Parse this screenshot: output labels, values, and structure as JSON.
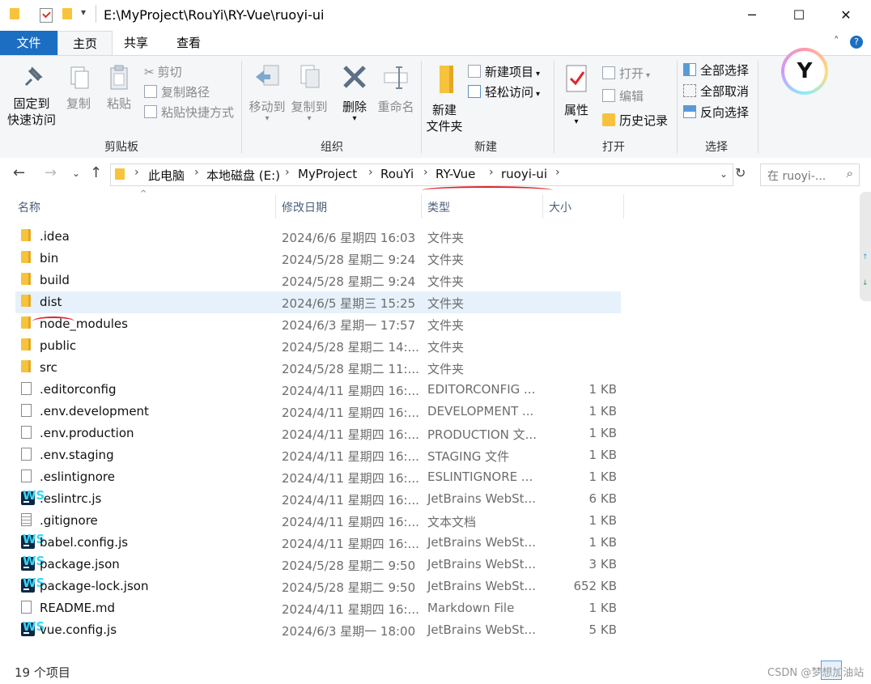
{
  "window": {
    "title": "E:\\MyProject\\RouYi\\RY-Vue\\ruoyi-ui",
    "min_glyph": "─",
    "max_glyph": "☐",
    "close_glyph": "✕"
  },
  "tabs": [
    "文件",
    "主页",
    "共享",
    "查看"
  ],
  "ribbon": {
    "clipboard": {
      "pin_label_1": "固定到",
      "pin_label_2": "快速访问",
      "copy": "复制",
      "paste": "粘贴",
      "cut": "剪切",
      "copy_path": "复制路径",
      "paste_shortcut": "粘贴快捷方式",
      "group": "剪贴板"
    },
    "organize": {
      "move_to": "移动到",
      "copy_to": "复制到",
      "delete": "删除",
      "rename": "重命名",
      "group": "组织"
    },
    "new": {
      "new_folder_1": "新建",
      "new_folder_2": "文件夹",
      "new_item": "新建项目",
      "easy_access": "轻松访问",
      "group": "新建"
    },
    "open": {
      "properties": "属性",
      "open": "打开",
      "edit": "编辑",
      "history": "历史记录",
      "group": "打开"
    },
    "select": {
      "select_all": "全部选择",
      "select_none": "全部取消",
      "invert": "反向选择",
      "group": "选择"
    }
  },
  "address": {
    "crumbs": [
      "此电脑",
      "本地磁盘 (E:)",
      "MyProject",
      "RouYi",
      "RY-Vue",
      "ruoyi-ui"
    ],
    "search_placeholder": "在 ruoyi-..."
  },
  "columns": [
    "名称",
    "修改日期",
    "类型",
    "大小"
  ],
  "files": [
    {
      "name": ".idea",
      "date": "2024/6/6 星期四 16:03",
      "type": "文件夹",
      "size": "",
      "icon": "folder"
    },
    {
      "name": "bin",
      "date": "2024/5/28 星期二 9:24",
      "type": "文件夹",
      "size": "",
      "icon": "folder"
    },
    {
      "name": "build",
      "date": "2024/5/28 星期二 9:24",
      "type": "文件夹",
      "size": "",
      "icon": "folder"
    },
    {
      "name": "dist",
      "date": "2024/6/5 星期三 15:25",
      "type": "文件夹",
      "size": "",
      "icon": "folder",
      "selected": true
    },
    {
      "name": "node_modules",
      "date": "2024/6/3 星期一 17:57",
      "type": "文件夹",
      "size": "",
      "icon": "folder"
    },
    {
      "name": "public",
      "date": "2024/5/28 星期二 14:...",
      "type": "文件夹",
      "size": "",
      "icon": "folder"
    },
    {
      "name": "src",
      "date": "2024/5/28 星期二 11:...",
      "type": "文件夹",
      "size": "",
      "icon": "folder"
    },
    {
      "name": ".editorconfig",
      "date": "2024/4/11 星期四 16:...",
      "type": "EDITORCONFIG ...",
      "size": "1 KB",
      "icon": "file"
    },
    {
      "name": ".env.development",
      "date": "2024/4/11 星期四 16:...",
      "type": "DEVELOPMENT ...",
      "size": "1 KB",
      "icon": "file"
    },
    {
      "name": ".env.production",
      "date": "2024/4/11 星期四 16:...",
      "type": "PRODUCTION 文...",
      "size": "1 KB",
      "icon": "file"
    },
    {
      "name": ".env.staging",
      "date": "2024/4/11 星期四 16:...",
      "type": "STAGING 文件",
      "size": "1 KB",
      "icon": "file"
    },
    {
      "name": ".eslintignore",
      "date": "2024/4/11 星期四 16:...",
      "type": "ESLINTIGNORE ...",
      "size": "1 KB",
      "icon": "file"
    },
    {
      "name": ".eslintrc.js",
      "date": "2024/4/11 星期四 16:...",
      "type": "JetBrains WebSt...",
      "size": "6 KB",
      "icon": "ws"
    },
    {
      "name": ".gitignore",
      "date": "2024/4/11 星期四 16:...",
      "type": "文本文档",
      "size": "1 KB",
      "icon": "text"
    },
    {
      "name": "babel.config.js",
      "date": "2024/4/11 星期四 16:...",
      "type": "JetBrains WebSt...",
      "size": "1 KB",
      "icon": "ws"
    },
    {
      "name": "package.json",
      "date": "2024/5/28 星期二 9:50",
      "type": "JetBrains WebSt...",
      "size": "3 KB",
      "icon": "ws"
    },
    {
      "name": "package-lock.json",
      "date": "2024/5/28 星期二 9:50",
      "type": "JetBrains WebSt...",
      "size": "652 KB",
      "icon": "ws"
    },
    {
      "name": "README.md",
      "date": "2024/4/11 星期四 16:...",
      "type": "Markdown File",
      "size": "1 KB",
      "icon": "file"
    },
    {
      "name": "vue.config.js",
      "date": "2024/6/3 星期一 18:00",
      "type": "JetBrains WebSt...",
      "size": "5 KB",
      "icon": "ws"
    }
  ],
  "status": "19 个项目",
  "watermark": "CSDN @梦想加油站",
  "colors": {
    "accent": "#1b6ec2",
    "selected_row": "#e6f1fb",
    "annotation": "#e0262a"
  }
}
